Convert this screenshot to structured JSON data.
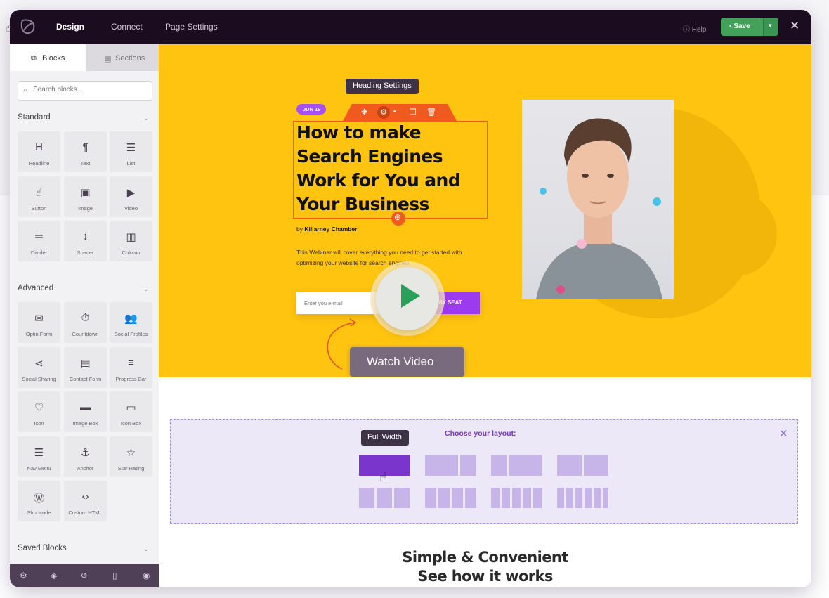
{
  "topbar": {
    "tabs": [
      "Design",
      "Connect",
      "Page Settings"
    ],
    "active_tab": "Design",
    "help": "Help",
    "save": "Save",
    "close": "✕"
  },
  "sidebar": {
    "tabs": {
      "blocks": "Blocks",
      "sections": "Sections"
    },
    "search_placeholder": "Search blocks...",
    "standard": {
      "title": "Standard",
      "blocks": [
        {
          "icon": "heading-icon",
          "glyph": "H",
          "label": "Headline"
        },
        {
          "icon": "paragraph-icon",
          "glyph": "¶",
          "label": "Text"
        },
        {
          "icon": "list-icon",
          "glyph": "☰",
          "label": "List"
        },
        {
          "icon": "button-hand-icon",
          "glyph": "☝",
          "label": "Button"
        },
        {
          "icon": "image-icon",
          "glyph": "▣",
          "label": "Image"
        },
        {
          "icon": "video-icon",
          "glyph": "▶",
          "label": "Video"
        },
        {
          "icon": "divider-icon",
          "glyph": "═",
          "label": "Divider"
        },
        {
          "icon": "spacer-icon",
          "glyph": "↕",
          "label": "Spacer"
        },
        {
          "icon": "column-icon",
          "glyph": "▥",
          "label": "Column"
        }
      ]
    },
    "advanced": {
      "title": "Advanced",
      "blocks": [
        {
          "icon": "envelope-icon",
          "glyph": "✉",
          "label": "Optin Form"
        },
        {
          "icon": "stopwatch-icon",
          "glyph": "⏱",
          "label": "Countdown"
        },
        {
          "icon": "users-icon",
          "glyph": "👥",
          "label": "Social Profiles"
        },
        {
          "icon": "share-icon",
          "glyph": "⋖",
          "label": "Social Sharing"
        },
        {
          "icon": "form-icon",
          "glyph": "▤",
          "label": "Contact Form"
        },
        {
          "icon": "progress-bars-icon",
          "glyph": "≡",
          "label": "Progress Bar"
        },
        {
          "icon": "heart-icon",
          "glyph": "♡",
          "label": "Icon"
        },
        {
          "icon": "image-box-icon",
          "glyph": "▬",
          "label": "Image Box"
        },
        {
          "icon": "icon-box-icon",
          "glyph": "▭",
          "label": "Icon Box"
        },
        {
          "icon": "hamburger-menu-icon",
          "glyph": "☰",
          "label": "Nav Menu"
        },
        {
          "icon": "anchor-icon",
          "glyph": "⚓",
          "label": "Anchor"
        },
        {
          "icon": "star-icon",
          "glyph": "☆",
          "label": "Star Rating"
        },
        {
          "icon": "wordpress-icon",
          "glyph": "Ⓦ",
          "label": "Shortcode"
        },
        {
          "icon": "code-icon",
          "glyph": "‹›",
          "label": "Custom HTML"
        }
      ]
    },
    "saved": {
      "title": "Saved Blocks"
    },
    "footer_icons": [
      "gear-icon",
      "layers-icon",
      "history-icon",
      "mobile-icon",
      "eye-icon"
    ]
  },
  "hero": {
    "tooltip": "Heading Settings",
    "date_badge": "JUN 19",
    "headline": "How to make Search Engines Work for You and Your Business",
    "byline_prefix": "by ",
    "byline_name": "Killarney Chamber",
    "description": "This Webinar will cover everything you need to get started with optimizing your website for search engines.",
    "email_placeholder": "Enter you e-mail",
    "seat_button": "VE MY SEAT",
    "watch_video": "Watch Video",
    "accent_color": "#fec40f"
  },
  "layout_chooser": {
    "title": "Choose your layout:",
    "tooltip": "Full Width",
    "close": "✕"
  },
  "bottom": {
    "line1": "Simple & Convenient",
    "line2": "See how it works"
  }
}
